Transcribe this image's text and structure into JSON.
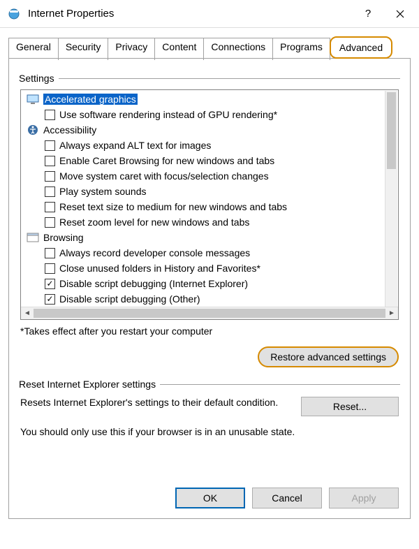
{
  "window": {
    "title": "Internet Properties"
  },
  "tabs": [
    "General",
    "Security",
    "Privacy",
    "Content",
    "Connections",
    "Programs",
    "Advanced"
  ],
  "active_tab_index": 6,
  "settings": {
    "group_title": "Settings",
    "footnote": "*Takes effect after you restart your computer",
    "restore_button": "Restore advanced settings",
    "categories": [
      {
        "icon": "monitor-icon",
        "label": "Accelerated graphics",
        "selected": true,
        "items": [
          {
            "label": "Use software rendering instead of GPU rendering*",
            "checked": false
          }
        ]
      },
      {
        "icon": "accessibility-icon",
        "label": "Accessibility",
        "selected": false,
        "items": [
          {
            "label": "Always expand ALT text for images",
            "checked": false
          },
          {
            "label": "Enable Caret Browsing for new windows and tabs",
            "checked": false
          },
          {
            "label": "Move system caret with focus/selection changes",
            "checked": false
          },
          {
            "label": "Play system sounds",
            "checked": false
          },
          {
            "label": "Reset text size to medium for new windows and tabs",
            "checked": false
          },
          {
            "label": "Reset zoom level for new windows and tabs",
            "checked": false
          }
        ]
      },
      {
        "icon": "window-icon",
        "label": "Browsing",
        "selected": false,
        "items": [
          {
            "label": "Always record developer console messages",
            "checked": false
          },
          {
            "label": "Close unused folders in History and Favorites*",
            "checked": false
          },
          {
            "label": "Disable script debugging (Internet Explorer)",
            "checked": true
          },
          {
            "label": "Disable script debugging (Other)",
            "checked": true
          }
        ]
      }
    ]
  },
  "reset": {
    "group_title": "Reset Internet Explorer settings",
    "desc": "Resets Internet Explorer's settings to their default condition.",
    "button": "Reset...",
    "warn": "You should only use this if your browser is in an unusable state."
  },
  "dialog_buttons": {
    "ok": "OK",
    "cancel": "Cancel",
    "apply": "Apply"
  }
}
